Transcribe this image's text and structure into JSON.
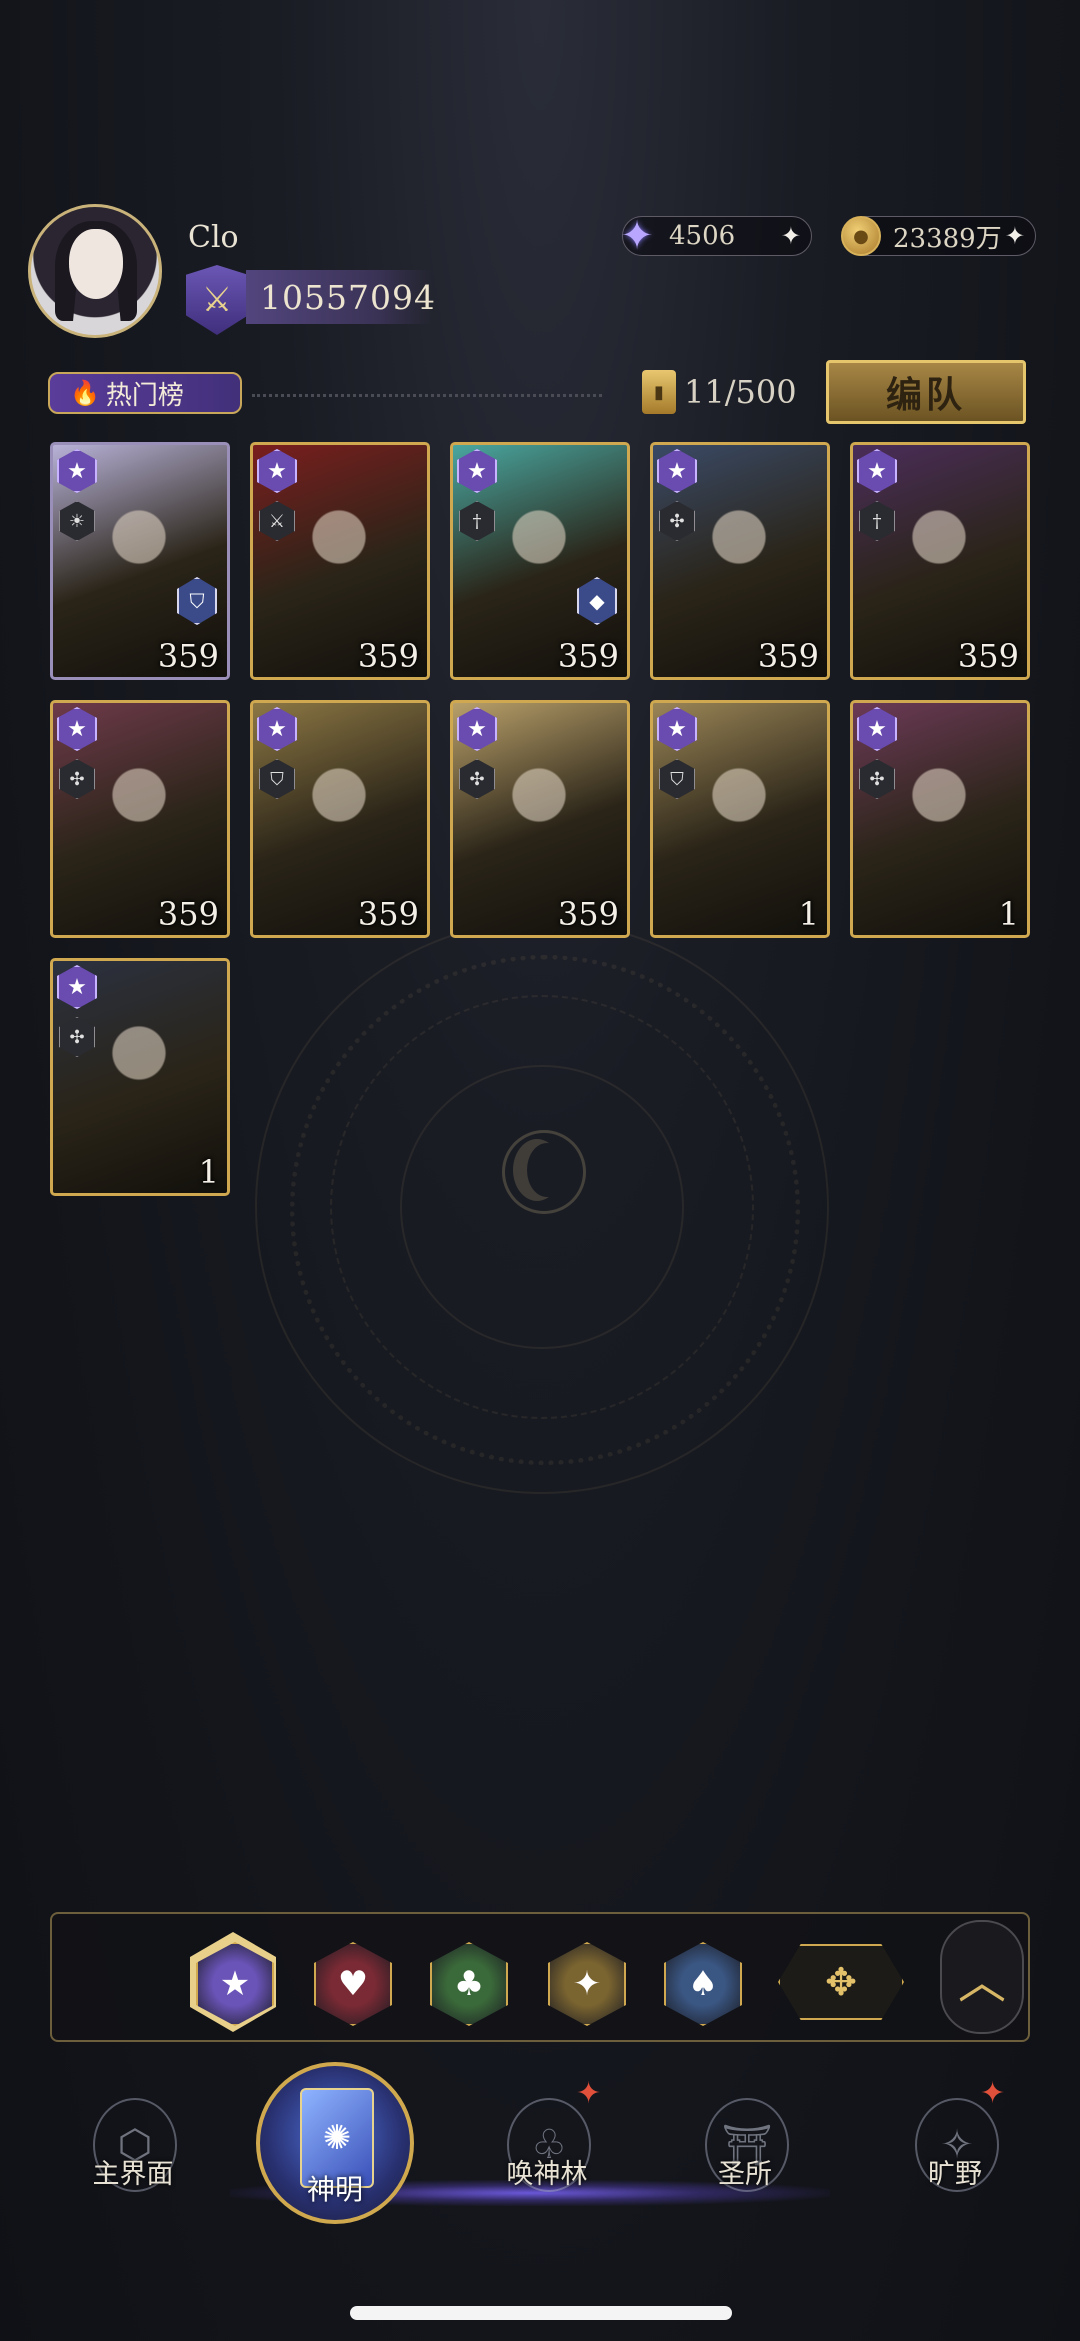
{
  "profile": {
    "name": "Clo",
    "power_icon": "crossed-swords-icon",
    "power": "10557094"
  },
  "currencies": {
    "stars": {
      "icon": "star-crystal-icon",
      "value": "4506",
      "add": "✦"
    },
    "gold": {
      "icon": "gold-coin-icon",
      "value": "23389万",
      "add": "✦"
    }
  },
  "toolbar": {
    "rank_label": "热门榜",
    "capacity": "11/500",
    "team_button": "编队"
  },
  "cards": [
    {
      "level": "359",
      "class_icon": "sun-icon",
      "element_icon": "shield-icon",
      "tint": "#b8b2d8",
      "frame": "#9a8fb8"
    },
    {
      "level": "359",
      "class_icon": "crossed-swords-icon",
      "element_icon": "",
      "tint": "#7a1e1e",
      "frame": "#cfa84f"
    },
    {
      "level": "359",
      "class_icon": "dagger-icon",
      "element_icon": "gem-icon",
      "tint": "#49a7a0",
      "frame": "#cfa84f"
    },
    {
      "level": "359",
      "class_icon": "crosshair-icon",
      "element_icon": "",
      "tint": "#3a4a66",
      "frame": "#cfa84f"
    },
    {
      "level": "359",
      "class_icon": "dagger-icon",
      "element_icon": "",
      "tint": "#4b2d5a",
      "frame": "#cfa84f"
    },
    {
      "level": "359",
      "class_icon": "crosshair-icon",
      "element_icon": "",
      "tint": "#6e3a4a",
      "frame": "#cfa84f"
    },
    {
      "level": "359",
      "class_icon": "shield-icon",
      "element_icon": "",
      "tint": "#8c7744",
      "frame": "#cfa84f"
    },
    {
      "level": "359",
      "class_icon": "crosshair-icon",
      "element_icon": "",
      "tint": "#b9a06a",
      "frame": "#cfa84f"
    },
    {
      "level": "1",
      "class_icon": "shield-icon",
      "element_icon": "",
      "tint": "#9a8556",
      "frame": "#cfa84f"
    },
    {
      "level": "1",
      "class_icon": "crosshair-icon",
      "element_icon": "",
      "tint": "#6c3a56",
      "frame": "#cfa84f"
    },
    {
      "level": "1",
      "class_icon": "crosshair-icon",
      "element_icon": "",
      "tint": "#2b3140",
      "frame": "#cfa84f"
    }
  ],
  "filters": [
    {
      "name": "star-filter-icon",
      "glyph": "★",
      "color": "#6a54b8",
      "selected": true
    },
    {
      "name": "heart-filter-icon",
      "glyph": "♥",
      "color": "#7a2a34",
      "selected": false
    },
    {
      "name": "clover-filter-icon",
      "glyph": "♣",
      "color": "#3b6a3a",
      "selected": false
    },
    {
      "name": "diamond-filter-icon",
      "glyph": "✦",
      "color": "#7a6430",
      "selected": false
    },
    {
      "name": "spade-filter-icon",
      "glyph": "♠",
      "color": "#3a5682",
      "selected": false
    }
  ],
  "filter_all_icon": "four-point-star-icon",
  "collapse_icon": "chevron-up-icon",
  "nav": [
    {
      "name": "nav-main-realm",
      "label": "主界面",
      "icon": "emblem-icon"
    },
    {
      "name": "nav-deities",
      "label": "神明",
      "icon": "spellbook-icon",
      "active": true
    },
    {
      "name": "nav-summon-forest",
      "label": "唤神林",
      "icon": "tree-icon",
      "alert": true
    },
    {
      "name": "nav-sanctuary",
      "label": "圣所",
      "icon": "sanctuary-icon"
    },
    {
      "name": "nav-wilds",
      "label": "旷野",
      "icon": "compass-icon",
      "alert": true
    }
  ]
}
